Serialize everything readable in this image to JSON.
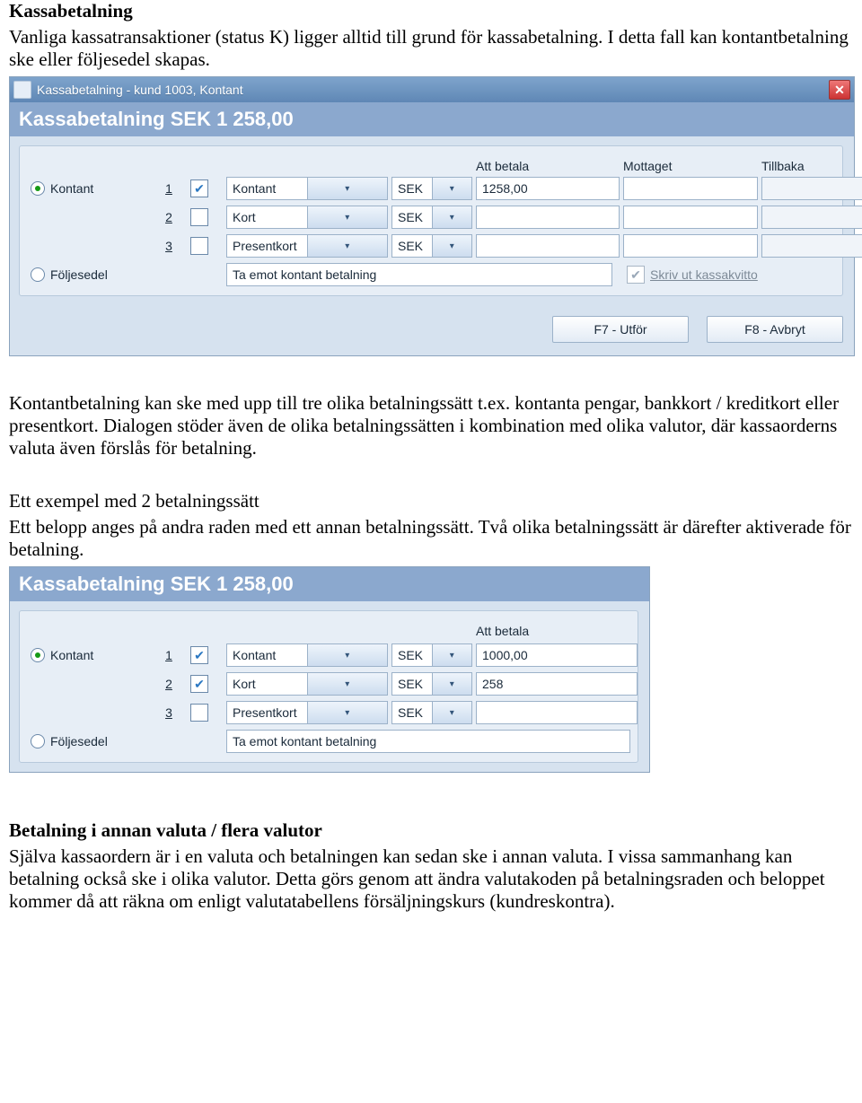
{
  "text": {
    "h1": "Kassabetalning",
    "p1": "Vanliga kassatransaktioner (status K) ligger alltid till grund för kassabetalning. I detta fall kan kontantbetalning ske eller följesedel skapas.",
    "p2": "Kontantbetalning kan ske med upp till tre olika betalningssätt t.ex. kontanta pengar, bankkort / kreditkort eller presentkort. Dialogen stöder även de olika betalningssätten i kombination med olika valutor, där kassaorderns valuta även förslås för betalning.",
    "h2": "Ett exempel med 2 betalningssätt",
    "p3": "Ett belopp anges på andra raden med ett annan betalningssätt. Två olika betalningssätt är därefter aktiverade för betalning.",
    "h3": "Betalning i annan valuta / flera valutor",
    "p4": "Själva kassaordern är i en valuta och betalningen kan sedan ske i annan valuta. I vissa sammanhang kan betalning också ske i olika valutor. Detta görs genom att ändra valutakoden på betalningsraden och beloppet kommer då att räkna om enligt valutatabellens försäljningskurs (kundreskontra)."
  },
  "d1": {
    "title": "Kassabetalning - kund 1003, Kontant",
    "header": "Kassabetalning SEK 1 258,00",
    "col_att": "Att betala",
    "col_mot": "Mottaget",
    "col_til": "Tillbaka",
    "r_kontant": "Kontant",
    "r_folje": "Följesedel",
    "n1": "1",
    "n2": "2",
    "n3": "3",
    "m1": "Kontant",
    "m2": "Kort",
    "m3": "Presentkort",
    "cur": "SEK",
    "v1": "1258,00",
    "v2": "",
    "v3": "",
    "msg": "Ta emot kontant betalning",
    "receipt": "Skriv ut kassakvitto",
    "btn1": "F7 - Utför",
    "btn2": "F8 - Avbryt"
  },
  "d2": {
    "header": "Kassabetalning SEK 1 258,00",
    "col_att": "Att betala",
    "r_kontant": "Kontant",
    "r_folje": "Följesedel",
    "n1": "1",
    "n2": "2",
    "n3": "3",
    "m1": "Kontant",
    "m2": "Kort",
    "m3": "Presentkort",
    "cur": "SEK",
    "v1": "1000,00",
    "v2": "258",
    "v3": "",
    "msg": "Ta emot kontant betalning"
  }
}
